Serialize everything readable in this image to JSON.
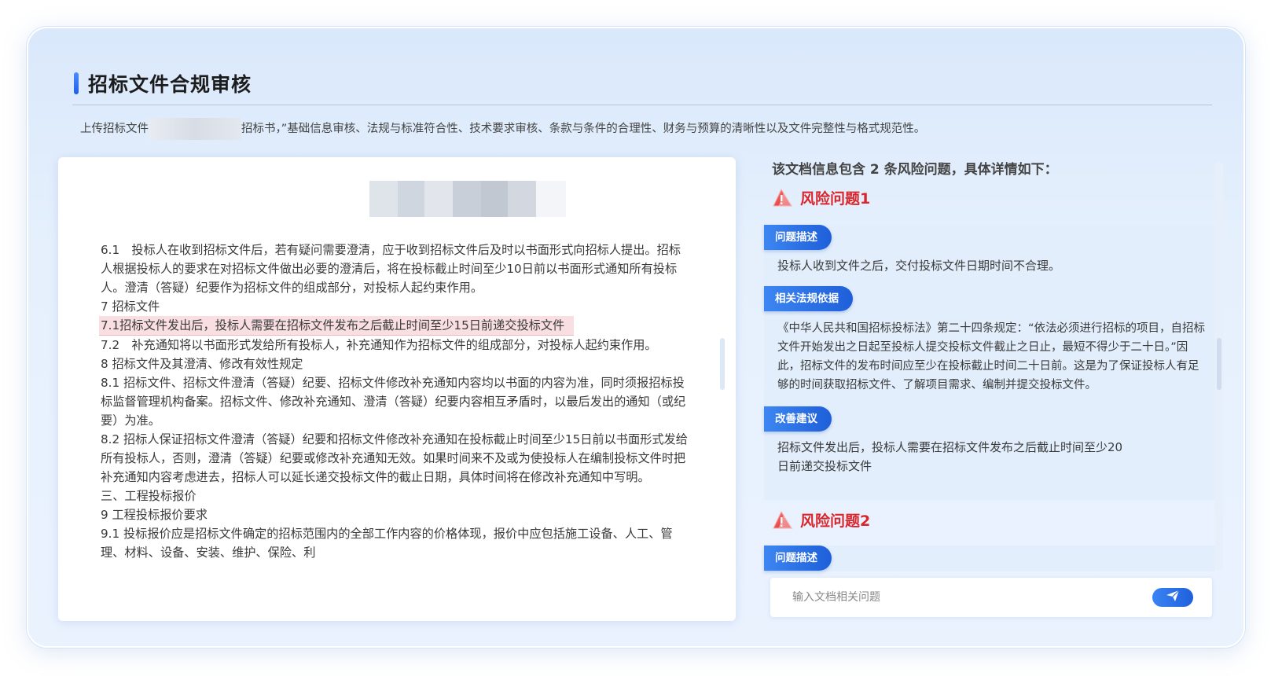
{
  "page": {
    "title": "招标文件合规审核",
    "subtitle_prefix": "上传招标文件",
    "subtitle_suffix": "招标书，”基础信息审核、法规与标准符合性、技术要求审核、条款与条件的合理性、财务与预算的清晰性以及文件完整性与格式规范性。"
  },
  "document": {
    "paragraphs": [
      "6.1　投标人在收到招标文件后，若有疑问需要澄清，应于收到招标文件后及时以书面形式向招标人提出。招标人根据投标人的要求在对招标文件做出必要的澄清后，将在投标截止时间至少10日前以书面形式通知所有投标人。澄清（答疑）纪要作为招标文件的组成部分，对投标人起约束作用。",
      "7 招标文件"
    ],
    "highlighted": "7.1招标文件发出后，投标人需要在招标文件发布之后截止时间至少15日前递交投标文件",
    "paragraphs_after": [
      "7.2　补充通知将以书面形式发给所有投标人，补充通知作为招标文件的组成部分，对投标人起约束作用。",
      "8 招标文件及其澄清、修改有效性规定",
      "8.1 招标文件、招标文件澄清（答疑）纪要、招标文件修改补充通知内容均以书面的内容为准，同时须报招标投标监督管理机构备案。招标文件、修改补充通知、澄清（答疑）纪要内容相互矛盾时，以最后发出的通知（或纪要）为准。",
      "8.2 招标人保证招标文件澄清（答疑）纪要和招标文件修改补充通知在投标截止时间至少15日前以书面形式发给所有投标人，否则，澄清（答疑）纪要或修改补充通知无效。如果时间来不及或为使投标人在编制投标文件时把补充通知内容考虑进去，招标人可以延长递交投标文件的截止日期，具体时间将在修改补充通知中写明。",
      "三、工程投标报价",
      "9 工程投标报价要求",
      "9.1 投标报价应是招标文件确定的招标范围内的全部工作内容的价格体现，报价中应包括施工设备、人工、管理、材料、设备、安装、维护、保险、利"
    ]
  },
  "risks": {
    "header": "该文档信息包含 2 条风险问题，具体详情如下：",
    "items": [
      {
        "title": "风险问题1",
        "desc_label": "问题描述",
        "desc": "投标人收到文件之后，交付投标文件日期时间不合理。",
        "law_label": "相关法规依据",
        "law": "《中华人民共和国招标投标法》第二十四条规定：“依法必须进行招标的项目，自招标文件开始发出之日起至投标人提交投标文件截止之日止，最短不得少于二十日。”因此，招标文件的发布时间应至少在投标截止时间二十日前。这是为了保证投标人有足够的时间获取招标文件、了解项目需求、编制并提交投标文件。",
        "suggest_label": "改善建议",
        "suggest_line1": "招标文件发出后，投标人需要在招标文件发布之后截止时间至少20",
        "suggest_line2": "日前递交投标文件"
      },
      {
        "title": "风险问题2",
        "desc_label": "问题描述"
      }
    ]
  },
  "chat_input": {
    "placeholder": "输入文档相关问题"
  },
  "icons": {
    "warning": "warning-triangle-icon",
    "send": "paper-plane-icon"
  },
  "colors": {
    "accent": "#1f5fdc",
    "risk": "#d9262c",
    "highlight": "#f9dfe2"
  }
}
